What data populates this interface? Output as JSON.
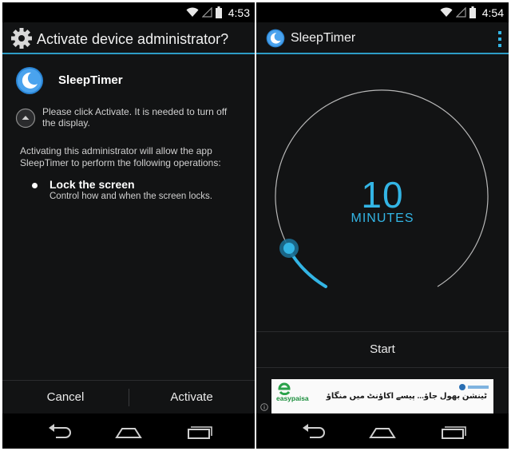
{
  "left": {
    "status": {
      "time": "4:53"
    },
    "dialog": {
      "title": "Activate device administrator?",
      "app_name": "SleepTimer",
      "info": "Please click Activate. It is needed to turn off the display.",
      "description": "Activating this administrator will allow the app SleepTimer to perform the following operations:",
      "permission": {
        "title": "Lock the screen",
        "desc": "Control how and when the screen locks."
      },
      "buttons": {
        "cancel": "Cancel",
        "activate": "Activate"
      }
    }
  },
  "right": {
    "status": {
      "time": "4:54"
    },
    "app": {
      "title": "SleepTimer",
      "timer": {
        "value": "10",
        "unit": "MINUTES"
      },
      "start_label": "Start"
    },
    "ad": {
      "brand": "easypaisa",
      "tagline": "ٹینشن بھول جاؤ... پیسے اکاؤنٹ میں منگاؤ"
    }
  },
  "colors": {
    "accent": "#33b5e5",
    "background": "#121314"
  },
  "icons": [
    "wifi-icon",
    "signal-icon",
    "battery-icon",
    "gear-icon",
    "moon-icon",
    "expand-icon",
    "overflow-menu-icon",
    "back-icon",
    "home-icon",
    "recents-icon",
    "ad-info-icon"
  ]
}
